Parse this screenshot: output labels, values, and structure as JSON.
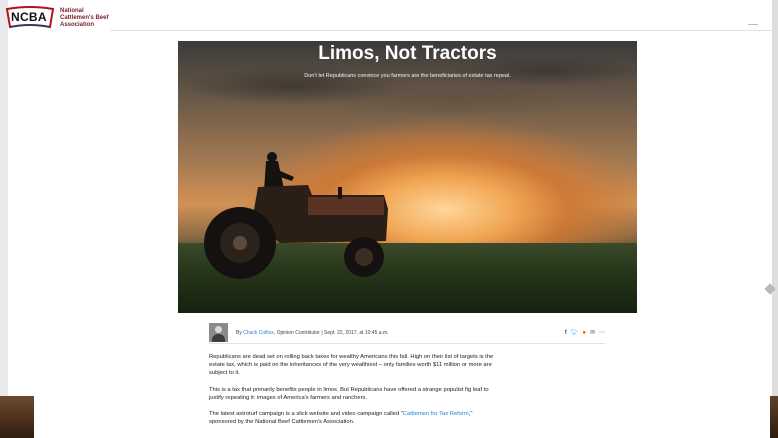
{
  "logo": {
    "abbrev": "NCBA",
    "name": "National Cattlemen's Beef Association",
    "colors": {
      "red": "#b5121b",
      "blue": "#1f3d7a"
    }
  },
  "article": {
    "title": "Limos, Not Tractors",
    "subtitle": "Don't let Republicans convince you farmers are the beneficiaries of estate tax repeal.",
    "byline": {
      "by": "By",
      "author": "Chuck Collins",
      "role_date": ", Opinion Contributor | Sept. 22, 2017, at 10:45 a.m."
    },
    "share_icons": [
      "facebook-icon",
      "twitter-icon",
      "reddit-icon",
      "email-icon",
      "more-icon"
    ],
    "paragraphs": {
      "p1": "Republicans are dead set on rolling back taxes for wealthy Americans this fall. High on their list of targets is the estate tax, which is paid on the inheritances of the very wealthiest – only families worth $11 million or more are subject to it.",
      "p2": "This is a tax that primarily benefits people in limos. But Republicans have offered a strange populist fig leaf to justify repealing it: images of America's farmers and ranchers.",
      "p3_before": "The latest astroturf campaign is a slick website and video campaign called \"",
      "p3_link": "Cattlemen for Tax Reform",
      "p3_after": ",\" sponsored by the National Beef Cattlemen's Association."
    }
  }
}
